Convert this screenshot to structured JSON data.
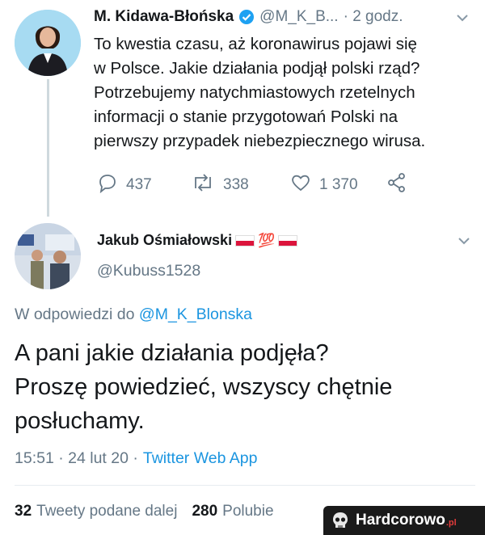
{
  "tweet1": {
    "author_name": "M. Kidawa-Błońska",
    "handle": "@M_K_B...",
    "time": "· 2 godz.",
    "text_lines": [
      "To kwestia czasu, aż koronawirus pojawi się",
      "w Polsce. Jakie działania podjął polski rząd?",
      "Potrzebujemy natychmiastowych rzetelnych",
      "informacji o stanie przygotowań Polski na",
      "pierwszy przypadek niebezpiecznego wirusa."
    ],
    "replies": "437",
    "retweets": "338",
    "likes": "1 370"
  },
  "tweet2": {
    "author_name": "Jakub Ośmiałowski",
    "emoji_100": "💯",
    "handle": "@Kubuss1528",
    "reply_to_prefix": "W odpowiedzi do",
    "reply_to_handle": "@M_K_Blonska",
    "text_lines": [
      "A pani jakie działania podjęła?",
      "Proszę powiedzieć, wszyscy chętnie",
      "posłuchamy."
    ],
    "timestamp": "15:51 · 24 lut 20 ·",
    "client": "Twitter Web App",
    "retweets_count": "32",
    "retweets_label": "Tweety podane dalej",
    "likes_count": "280",
    "likes_label": "Polubie"
  },
  "watermark": {
    "text": "Hardcorowo",
    "suffix": ".pl"
  },
  "colors": {
    "accent": "#1b95e0",
    "muted": "#657786",
    "verified": "#1da1f2"
  }
}
